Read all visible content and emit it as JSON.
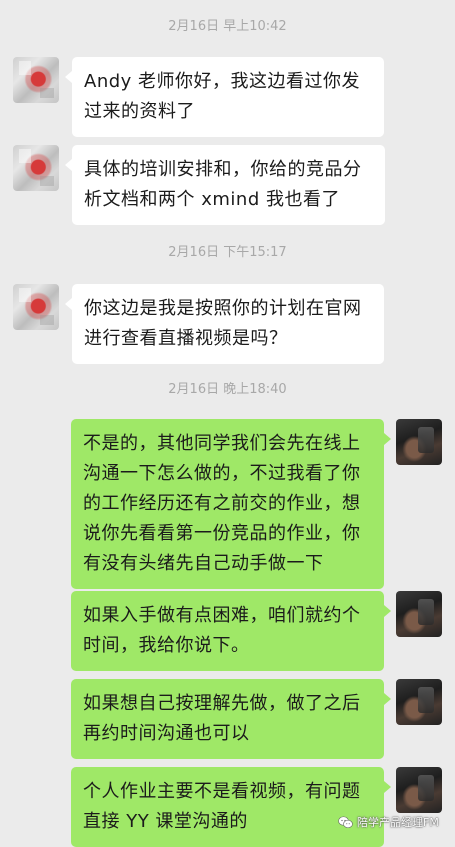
{
  "chat": {
    "messages": [
      {
        "type": "timestamp",
        "text": "2月16日 早上10:42"
      },
      {
        "type": "received",
        "text": "Andy 老师你好，我这边看过你发过来的资料了"
      },
      {
        "type": "received",
        "text": "具体的培训安排和，你给的竞品分析文档和两个 xmind 我也看了"
      },
      {
        "type": "timestamp",
        "text": "2月16日 下午15:17"
      },
      {
        "type": "received",
        "text": "你这边是我是按照你的计划在官网进行查看直播视频是吗？"
      },
      {
        "type": "timestamp",
        "text": "2月16日 晚上18:40"
      },
      {
        "type": "sent",
        "text": "不是的，其他同学我们会先在线上沟通一下怎么做的，不过我看了你的工作经历还有之前交的作业，想说你先看看第一份竞品的作业，你有没有头绪先自己动手做一下"
      },
      {
        "type": "sent",
        "text": "如果入手做有点困难，咱们就约个时间，我给你说下。"
      },
      {
        "type": "sent",
        "text": "如果想自己按理解先做，做了之后再约时间沟通也可以"
      },
      {
        "type": "sent",
        "text": "个人作业主要不是看视频，有问题直接 YY 课堂沟通的"
      }
    ]
  },
  "watermark": {
    "text": "陪学产品经理FM",
    "icon": "wechat-logo-icon"
  },
  "colors": {
    "background": "#ebebeb",
    "sent_bubble": "#9fe867",
    "received_bubble": "#ffffff",
    "timestamp_text": "#a8a8a8"
  }
}
